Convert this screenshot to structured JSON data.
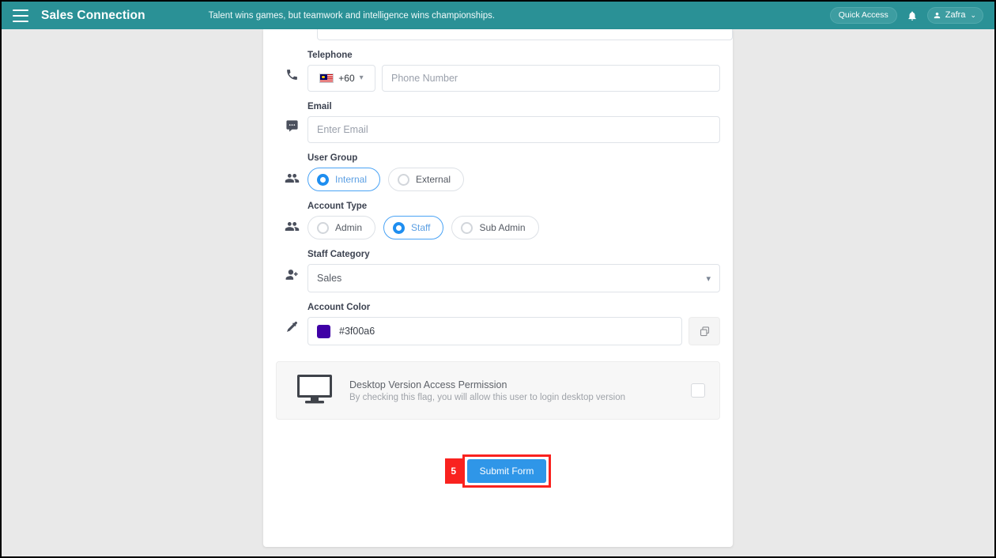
{
  "topbar": {
    "menu_icon": "hamburger-icon",
    "brand": "Sales Connection",
    "tagline": "Talent wins games, but teamwork and intelligence wins championships.",
    "quick_access_label": "Quick Access",
    "bell_icon": "bell-icon",
    "user_name": "Zafra",
    "user_caret": "⌄"
  },
  "form": {
    "telephone": {
      "label": "Telephone",
      "icon": "phone-icon",
      "country_flag": "malaysia-flag",
      "country_code": "+60",
      "phone_placeholder": "Phone Number",
      "phone_value": ""
    },
    "email": {
      "label": "Email",
      "icon": "message-icon",
      "placeholder": "Enter Email",
      "value": ""
    },
    "user_group": {
      "label": "User Group",
      "icon": "users-icon",
      "options": [
        {
          "label": "Internal",
          "selected": true
        },
        {
          "label": "External",
          "selected": false
        }
      ]
    },
    "account_type": {
      "label": "Account Type",
      "icon": "users-icon",
      "options": [
        {
          "label": "Admin",
          "selected": false
        },
        {
          "label": "Staff",
          "selected": true
        },
        {
          "label": "Sub Admin",
          "selected": false
        }
      ]
    },
    "staff_category": {
      "label": "Staff Category",
      "icon": "user-add-icon",
      "value": "Sales",
      "chevron": "⌄"
    },
    "account_color": {
      "label": "Account Color",
      "icon": "eyedropper-icon",
      "value": "#3f00a6",
      "swatch_hex": "#3f00a6",
      "copy_icon": "copy-icon"
    },
    "desktop_permission": {
      "icon": "monitor-icon",
      "title": "Desktop Version Access Permission",
      "subtitle": "By checking this flag, you will allow this user to login desktop version",
      "checked": false
    },
    "submit": {
      "label": "Submit Form",
      "annotation_number": "5"
    }
  },
  "colors": {
    "nav_teal": "#2a9196",
    "accent_blue": "#2f96e8",
    "annotation_red": "#f9221f",
    "page_bg": "#e9e9e9"
  }
}
